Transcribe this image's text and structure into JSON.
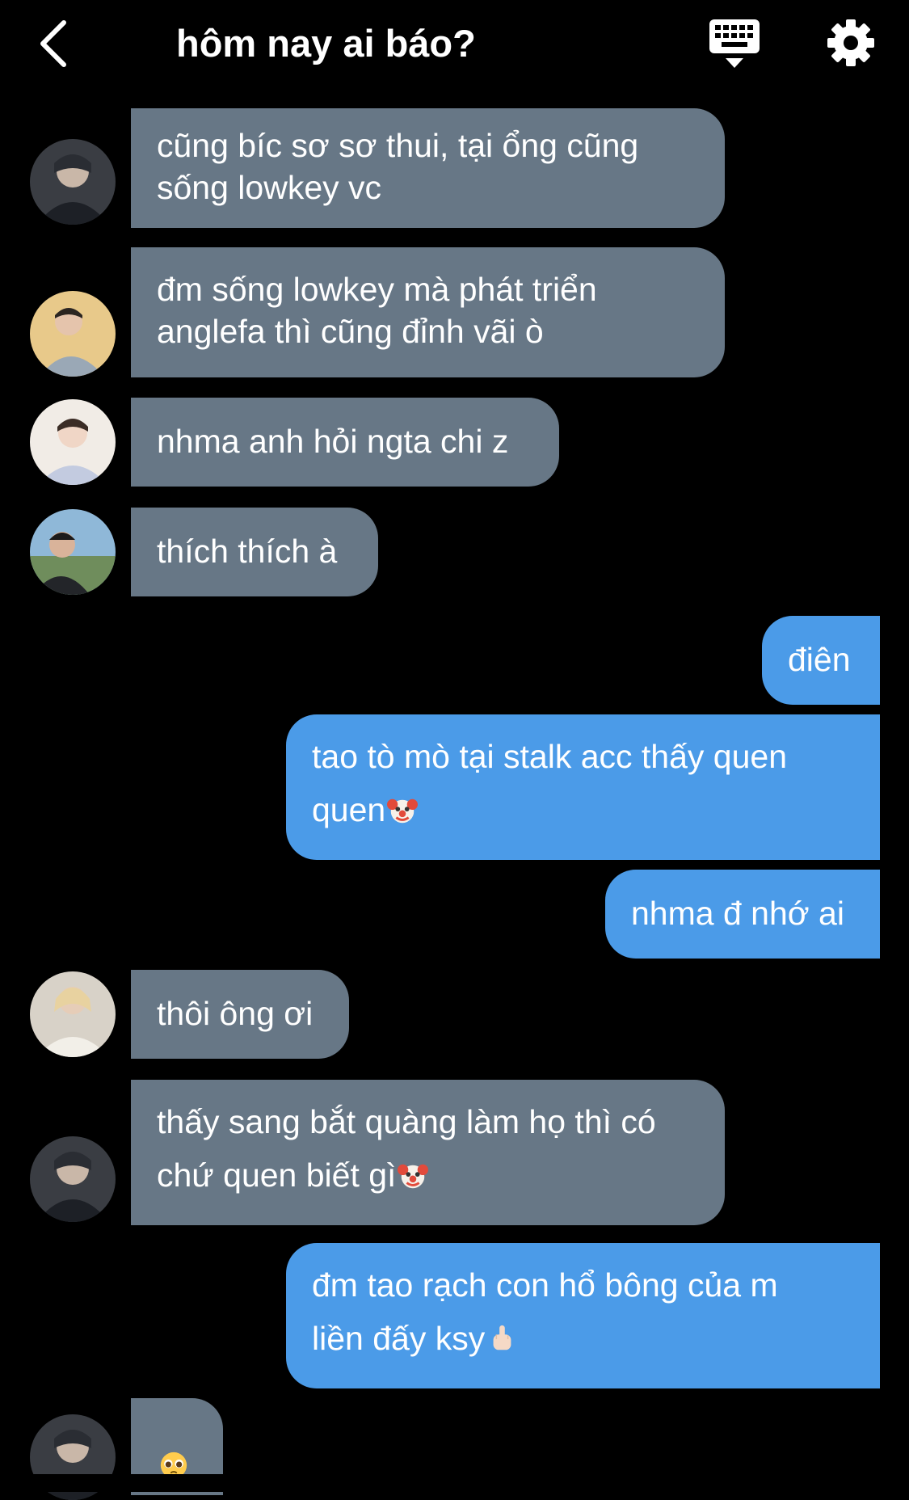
{
  "header": {
    "title": "hôm nay ai báo?",
    "icons": [
      "chevron-left-icon",
      "keyboard-icon",
      "gear-icon"
    ]
  },
  "colors": {
    "background": "#000000",
    "incoming_bubble": "#677786",
    "outgoing_bubble": "#4b9be8",
    "text": "#ffffff"
  },
  "messages": [
    {
      "side": "in",
      "lines": [
        "cũng bíc sơ sơ thui, tại ổng cũng",
        "sống lowkey vc"
      ]
    },
    {
      "side": "in",
      "lines": [
        "đm sống lowkey mà phát triển",
        "anglefa thì cũng đỉnh vãi ò"
      ]
    },
    {
      "side": "in",
      "lines": [
        "nhma anh hỏi ngta chi z"
      ]
    },
    {
      "side": "in",
      "lines": [
        "thích thích à"
      ]
    },
    {
      "side": "out",
      "lines": [
        "điên"
      ]
    },
    {
      "side": "out",
      "lines": [
        "tao tò mò tại stalk acc thấy quen",
        "quen"
      ],
      "emoji": "clown-face-emoji"
    },
    {
      "side": "out",
      "lines": [
        "nhma đ nhớ ai"
      ]
    },
    {
      "side": "in",
      "lines": [
        "thôi ông ơi"
      ]
    },
    {
      "side": "in",
      "lines": [
        "thấy sang bắt quàng làm họ thì có",
        "chứ quen biết gì"
      ],
      "emoji": "clown-face-emoji"
    },
    {
      "side": "out",
      "lines": [
        "đm tao rạch con hổ bông của m",
        "liền đấy ksy"
      ],
      "emoji": "middle-finger-emoji"
    },
    {
      "side": "in",
      "lines": [
        ""
      ],
      "emoji": "pleading-face-emoji"
    }
  ]
}
